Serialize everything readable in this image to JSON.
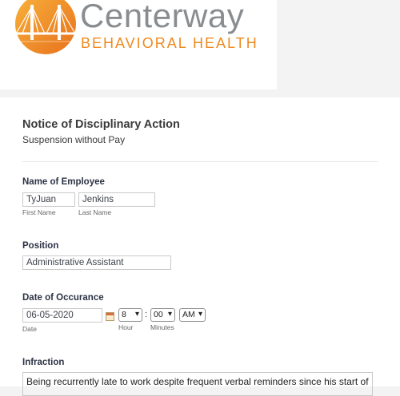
{
  "brand": {
    "name": "Centerway",
    "tagline": "BEHAVIORAL HEALTH",
    "colors": {
      "orange": "#ee8a1f",
      "gray": "#8a8d90"
    }
  },
  "form": {
    "title": "Notice of Disciplinary Action",
    "subtitle": "Suspension without Pay",
    "employee": {
      "label": "Name of Employee",
      "first_value": "TyJuan",
      "first_sublabel": "First Name",
      "last_value": "Jenkins",
      "last_sublabel": "Last Name"
    },
    "position": {
      "label": "Position",
      "value": "Administrative Assistant"
    },
    "date": {
      "label": "Date of Occurance",
      "value": "06-05-2020",
      "date_sublabel": "Date",
      "hour_value": "8",
      "hour_sublabel": "Hour",
      "separator": ":",
      "minutes_value": "00",
      "minutes_sublabel": "Minutes",
      "ampm_value": "AM"
    },
    "infraction": {
      "label": "Infraction",
      "value": "Being recurrently late to work despite frequent verbal reminders since his start of"
    }
  }
}
